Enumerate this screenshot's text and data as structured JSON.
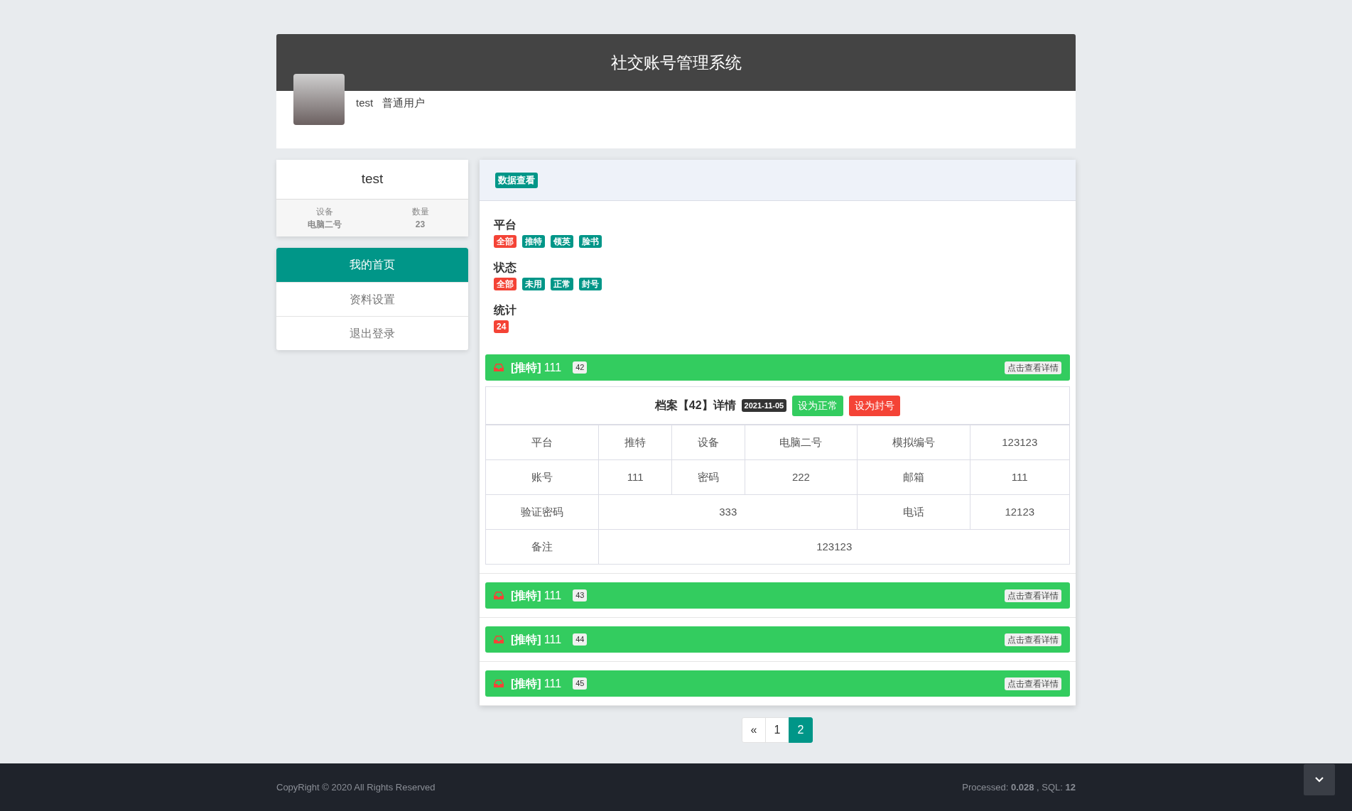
{
  "header": {
    "title": "社交账号管理系统",
    "username": "test",
    "role": "普通用户"
  },
  "user_card": {
    "name": "test",
    "stats": [
      {
        "label": "设备",
        "value": "电脑二号"
      },
      {
        "label": "数量",
        "value": "23"
      }
    ]
  },
  "menu": [
    {
      "label": "我的首页",
      "selected": true
    },
    {
      "label": "资料设置",
      "selected": false
    },
    {
      "label": "退出登录",
      "selected": false
    }
  ],
  "panel": {
    "tag": "数据查看",
    "filters": [
      {
        "title": "平台",
        "tags": [
          {
            "label": "全部",
            "selected": true
          },
          {
            "label": "推特",
            "selected": false
          },
          {
            "label": "领英",
            "selected": false
          },
          {
            "label": "脸书",
            "selected": false
          }
        ]
      },
      {
        "title": "状态",
        "tags": [
          {
            "label": "全部",
            "selected": true
          },
          {
            "label": "未用",
            "selected": false
          },
          {
            "label": "正常",
            "selected": false
          },
          {
            "label": "封号",
            "selected": false
          }
        ]
      }
    ],
    "total": {
      "title": "统计",
      "count": "24"
    },
    "records": [
      {
        "platform": "[推特]",
        "account": "111",
        "id": "42",
        "link": "点击查看详情",
        "detail": {
          "title": "档案【42】详情",
          "date": "2021-11-05",
          "buttons": [
            {
              "label": "设为正常",
              "kind": "success"
            },
            {
              "label": "设为封号",
              "kind": "danger"
            }
          ],
          "rows": [
            [
              "平台",
              "推特",
              "设备",
              "电脑二号",
              "模拟编号",
              "123123"
            ],
            [
              "账号",
              "111",
              "密码",
              "222",
              "邮箱",
              "111"
            ],
            [
              "验证密码",
              "333",
              null,
              null,
              "电话",
              "12123"
            ],
            [
              "备注",
              "123123",
              null,
              null,
              null,
              null
            ]
          ]
        }
      },
      {
        "platform": "[推特]",
        "account": "111",
        "id": "43",
        "link": "点击查看详情"
      },
      {
        "platform": "[推特]",
        "account": "111",
        "id": "44",
        "link": "点击查看详情"
      },
      {
        "platform": "[推特]",
        "account": "111",
        "id": "45",
        "link": "点击查看详情"
      }
    ]
  },
  "pagination": [
    {
      "label": "«",
      "selected": false
    },
    {
      "label": "1",
      "selected": false
    },
    {
      "label": "2",
      "selected": true
    }
  ],
  "footer": {
    "copyright": "CopyRight © 2020 All Rights Reserved",
    "stats": "Processed: **0.028** , SQL: **12**"
  }
}
